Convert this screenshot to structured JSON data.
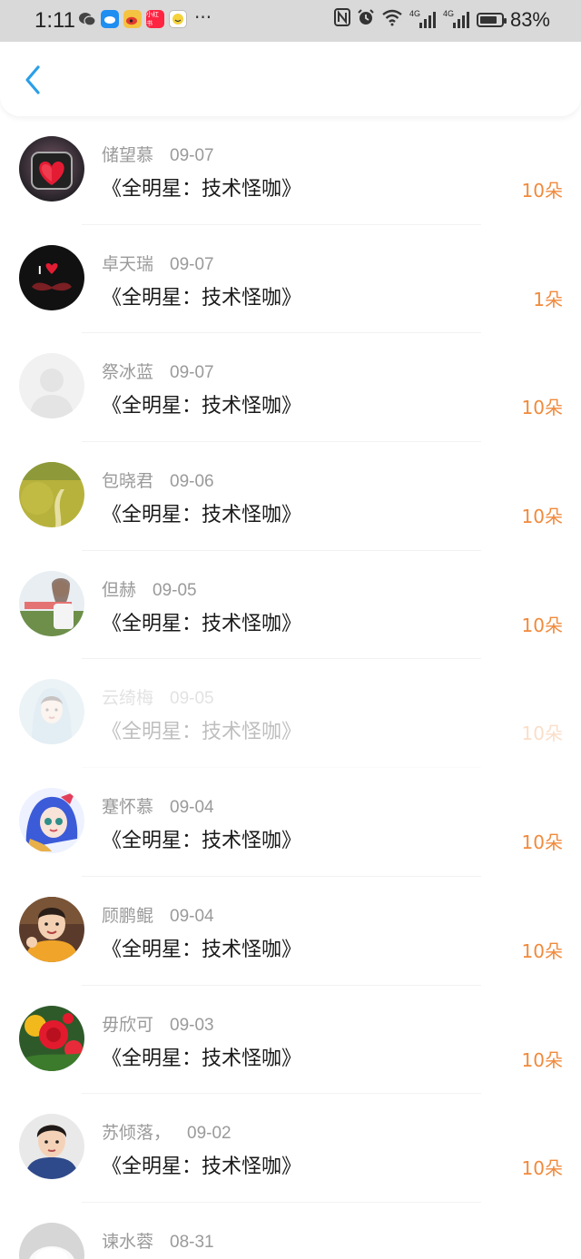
{
  "status_bar": {
    "time": "1:11",
    "battery_percent": "83%",
    "battery_level": 0.83,
    "more_indicator": "···",
    "network_label_1": "4G",
    "network_label_2": "4G",
    "app_icons": [
      "wechat-icon",
      "app-blue-icon",
      "weibo-icon",
      "xiaohongshu-icon",
      "app-yellow-icon"
    ],
    "xiaohongshu_text": "小红书"
  },
  "header": {
    "back_icon": "chevron-left-icon",
    "accent_color": "#2b9fe8"
  },
  "colors": {
    "amount": "#f08a3c",
    "name": "#9a9a9a",
    "title": "#1a1a1a"
  },
  "records": [
    {
      "name": "储望慕",
      "date": "09-07",
      "title": "《全明星：技术怪咖》",
      "amount": "10朵",
      "avatar": "heart-avatar"
    },
    {
      "name": "卓天瑞",
      "date": "09-07",
      "title": "《全明星：技术怪咖》",
      "amount": "1朵",
      "avatar": "mustache-avatar"
    },
    {
      "name": "祭冰蓝",
      "date": "09-07",
      "title": "《全明星：技术怪咖》",
      "amount": "10朵",
      "avatar": "default-avatar"
    },
    {
      "name": "包晓君",
      "date": "09-06",
      "title": "《全明星：技术怪咖》",
      "amount": "10朵",
      "avatar": "field-avatar"
    },
    {
      "name": "但赫",
      "date": "09-05",
      "title": "《全明星：技术怪咖》",
      "amount": "10朵",
      "avatar": "girl-photo-avatar"
    },
    {
      "name": "云绮梅",
      "date": "09-05",
      "title": "《全明星：技术怪咖》",
      "amount": "10朵",
      "avatar": "portrait-avatar",
      "faded": true
    },
    {
      "name": "蹇怀慕",
      "date": "09-04",
      "title": "《全明星：技术怪咖》",
      "amount": "10朵",
      "avatar": "anime-avatar"
    },
    {
      "name": "顾鹏鲲",
      "date": "09-04",
      "title": "《全明星：技术怪咖》",
      "amount": "10朵",
      "avatar": "child-avatar"
    },
    {
      "name": "毋欣可",
      "date": "09-03",
      "title": "《全明星：技术怪咖》",
      "amount": "10朵",
      "avatar": "flower-avatar"
    },
    {
      "name": "苏倾落，",
      "date": "09-02",
      "title": "《全明星：技术怪咖》",
      "amount": "10朵",
      "avatar": "boy-avatar"
    },
    {
      "name": "谏水蓉",
      "date": "08-31",
      "title": "",
      "amount": "",
      "avatar": "white-object-avatar"
    }
  ]
}
